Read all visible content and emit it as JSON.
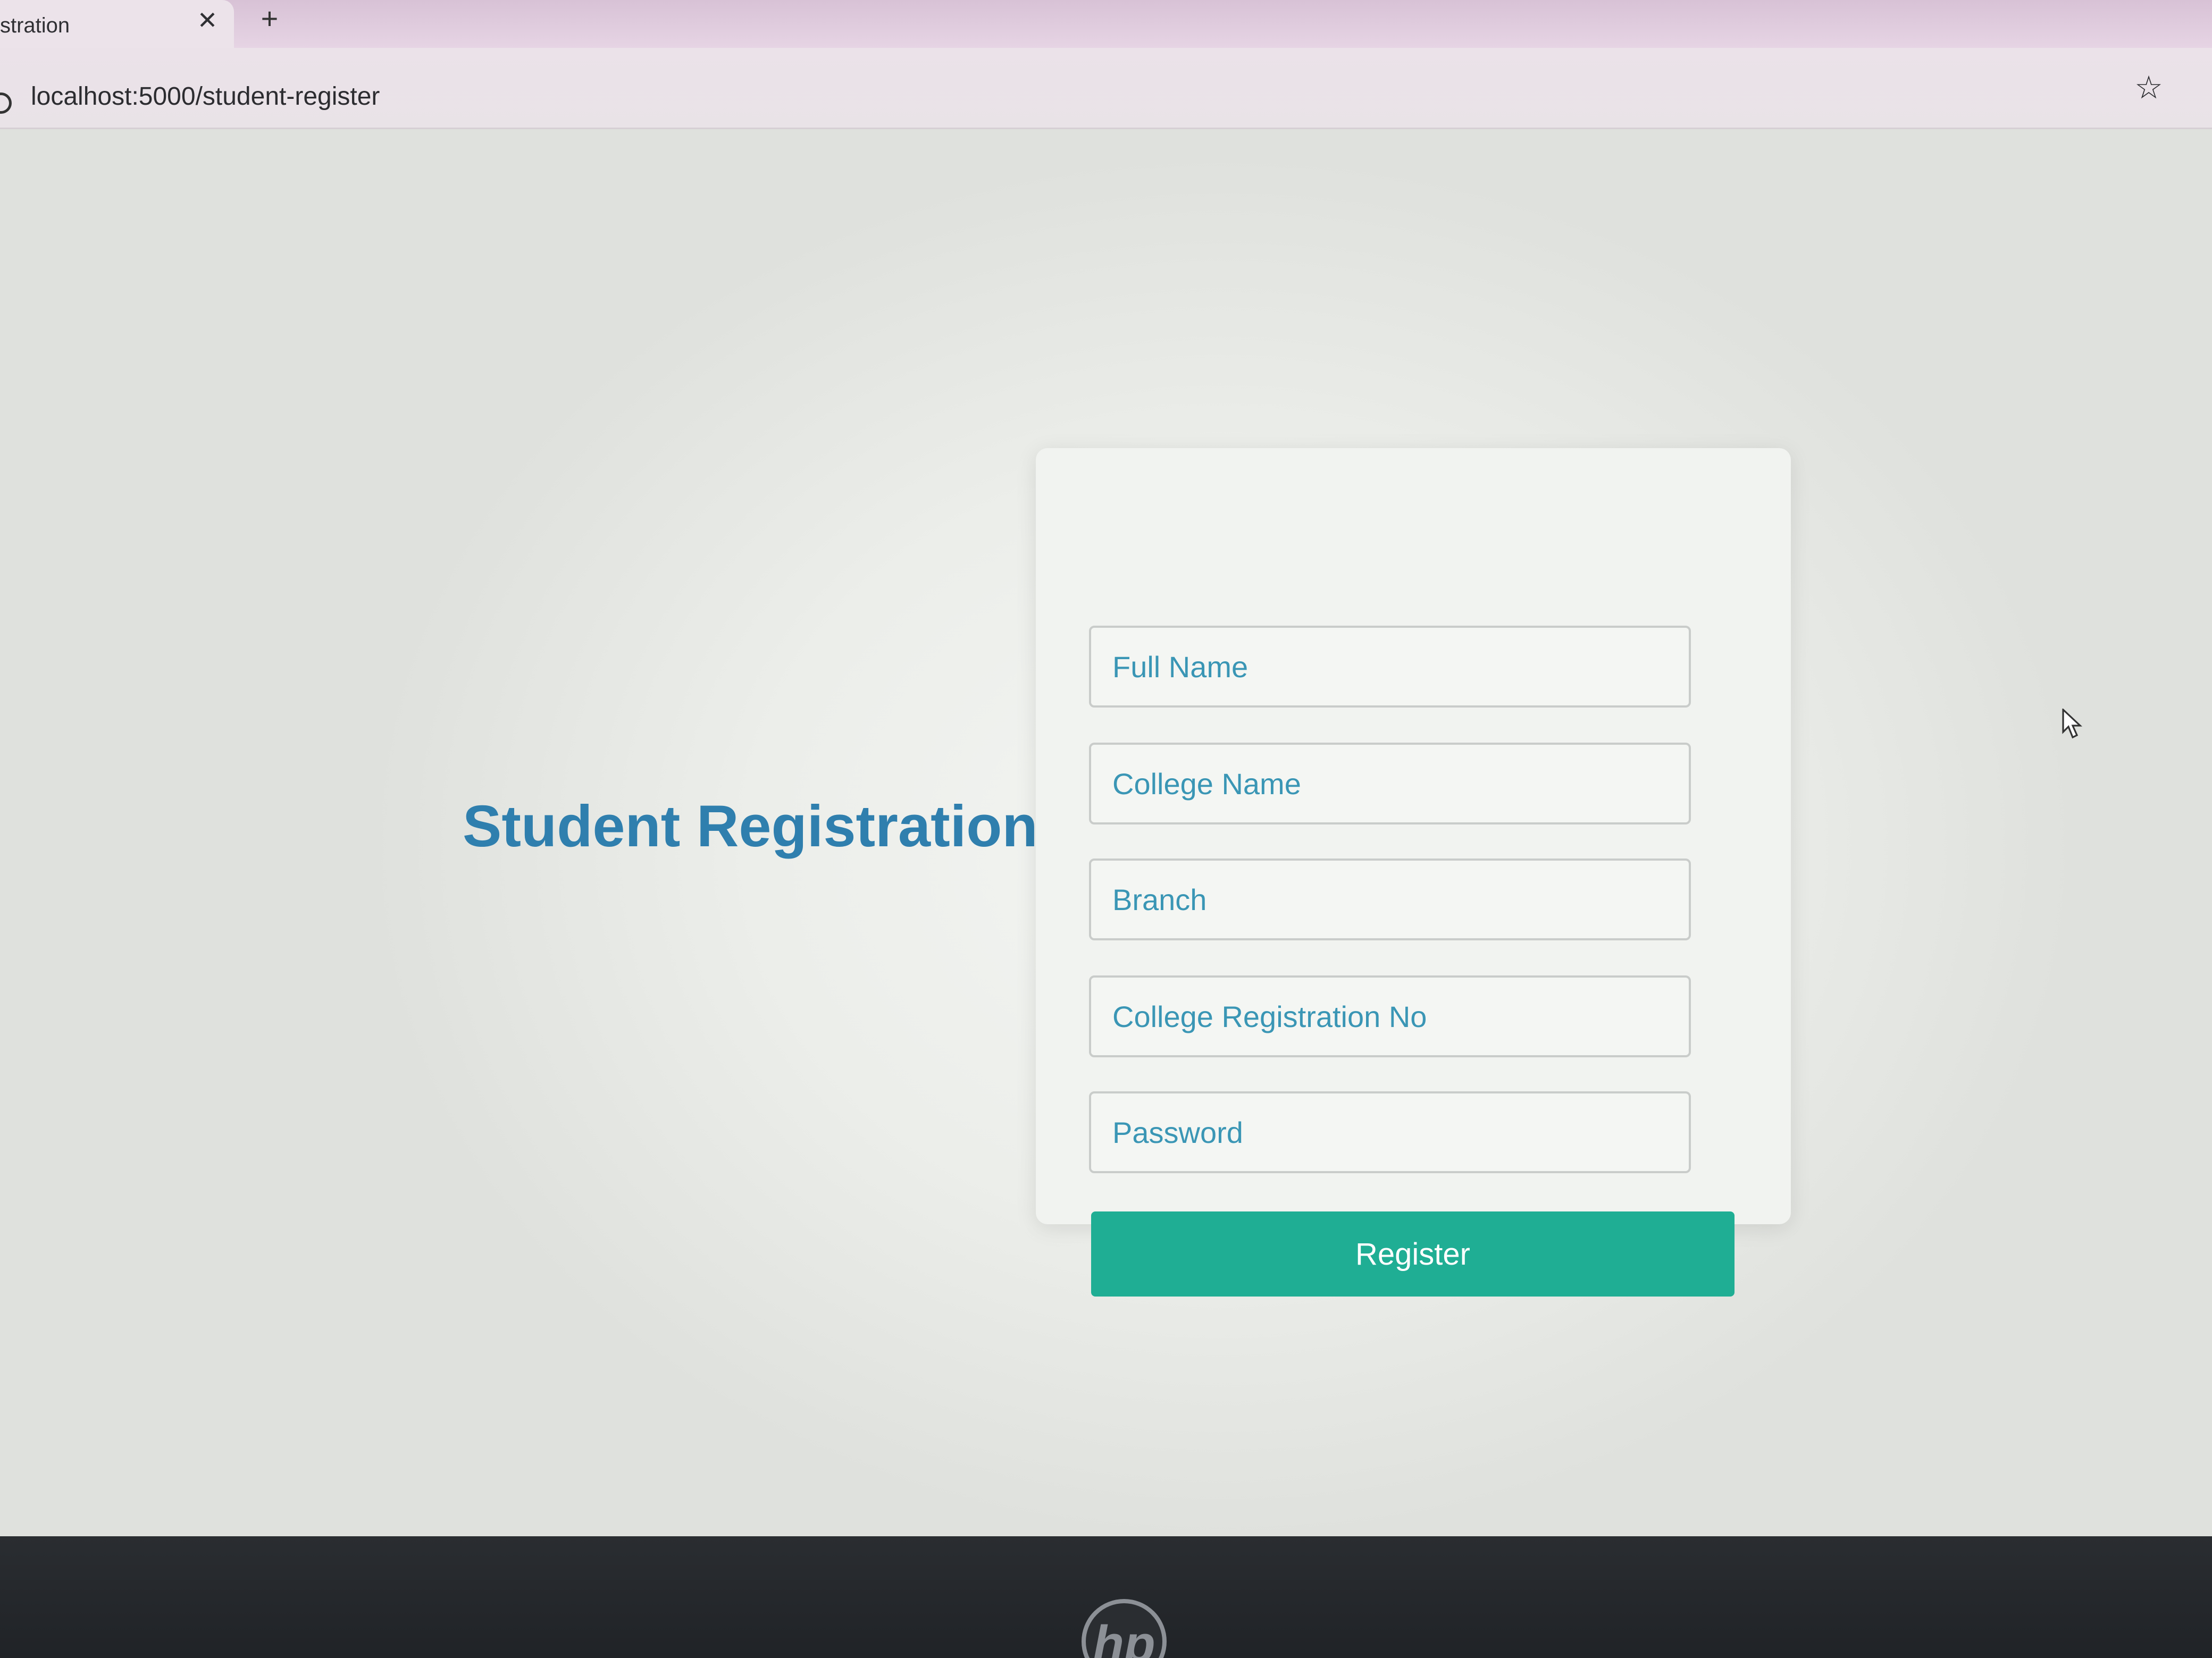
{
  "browser": {
    "tab_title": "stration",
    "tab_close_glyph": "✕",
    "new_tab_glyph": "+",
    "address": "localhost:5000/student-register",
    "bookmark_icon": "star-icon",
    "bookmark_glyph": "☆"
  },
  "page": {
    "title": "Student Registration",
    "form": {
      "fields": [
        {
          "placeholder": "Full Name",
          "value": ""
        },
        {
          "placeholder": "College Name",
          "value": ""
        },
        {
          "placeholder": "Branch",
          "value": ""
        },
        {
          "placeholder": "College Registration No",
          "value": ""
        },
        {
          "placeholder": "Password",
          "value": ""
        }
      ],
      "submit_label": "Register"
    }
  },
  "bezel": {
    "logo_text": "hp"
  },
  "colors": {
    "title": "#2f7fae",
    "accent_button": "#1fae94",
    "placeholder": "#3a96b5"
  }
}
